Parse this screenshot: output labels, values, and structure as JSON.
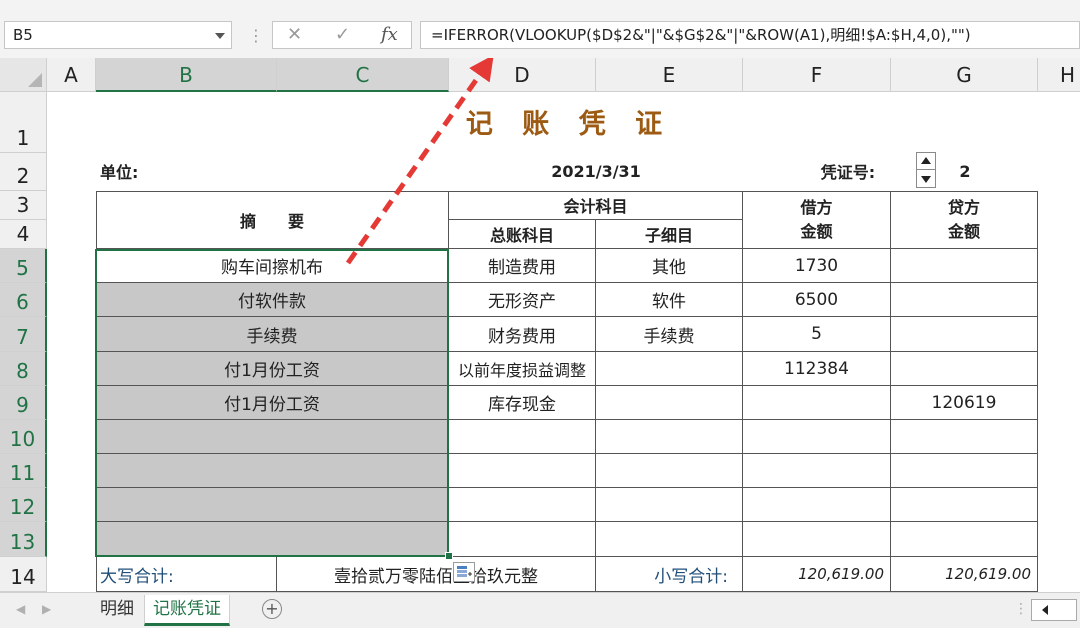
{
  "formula_bar": {
    "name_box": "B5",
    "cancel_glyph": "✕",
    "enter_glyph": "✓",
    "fx_label": "fx",
    "formula": "=IFERROR(VLOOKUP($D$2&\"|\"&$G$2&\"|\"&ROW(A1),明细!$A:$H,4,0),\"\")"
  },
  "columns": [
    "A",
    "B",
    "C",
    "D",
    "E",
    "F",
    "G",
    "H"
  ],
  "rows": [
    "1",
    "2",
    "3",
    "4",
    "5",
    "6",
    "7",
    "8",
    "9",
    "10",
    "11",
    "12",
    "13",
    "14"
  ],
  "sheet": {
    "title": "记 账 凭 证",
    "unit_label": "单位:",
    "date": "2021/3/31",
    "voucher_label": "凭证号:",
    "voucher_no": "2",
    "header_summary": "摘　　要",
    "header_accounts": "会计科目",
    "header_general": "总账科目",
    "header_sub": "子细目",
    "header_debit_1": "借方",
    "header_debit_2": "金额",
    "header_credit_1": "贷方",
    "header_credit_2": "金额",
    "entries": [
      {
        "summary": "购车间擦机布",
        "general": "制造费用",
        "sub": "其他",
        "debit": "1730",
        "credit": ""
      },
      {
        "summary": "付软件款",
        "general": "无形资产",
        "sub": "软件",
        "debit": "6500",
        "credit": ""
      },
      {
        "summary": "手续费",
        "general": "财务费用",
        "sub": "手续费",
        "debit": "5",
        "credit": ""
      },
      {
        "summary": "付1月份工资",
        "general": "以前年度损益调整",
        "sub": "",
        "debit": "112384",
        "credit": ""
      },
      {
        "summary": "付1月份工资",
        "general": "库存现金",
        "sub": "",
        "debit": "",
        "credit": "120619"
      }
    ],
    "total_caps_label": "大写合计:",
    "total_caps_value": "壹拾贰万零陆佰壹拾玖元整",
    "total_small_label": "小写合计:",
    "total_debit": "120,619.00",
    "total_credit": "120,619.00"
  },
  "tabs": {
    "prev_glyph": "◀",
    "next_glyph": "▶",
    "items": [
      "明细",
      "记账凭证"
    ],
    "active": "记账凭证",
    "add_glyph": "+"
  },
  "colors": {
    "accent": "#217346",
    "title": "#9c5a12",
    "arrow": "#e53935",
    "selection_fill": "#c8c8c8"
  }
}
